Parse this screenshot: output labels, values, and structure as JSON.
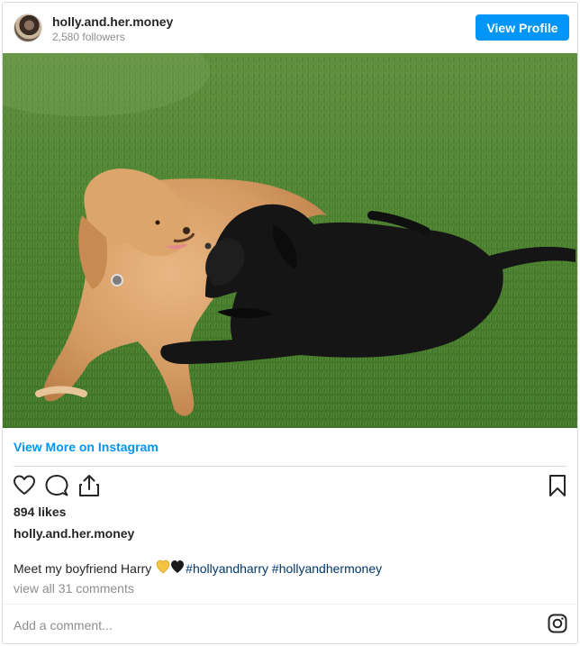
{
  "header": {
    "username": "holly.and.her.money",
    "followers": "2,580 followers",
    "view_profile_label": "View Profile"
  },
  "photo": {
    "description_icon": "two-dogs-photo"
  },
  "view_more_label": "View More on Instagram",
  "actions": {
    "like_icon": "heart-icon",
    "comment_icon": "comment-icon",
    "share_icon": "share-icon",
    "save_icon": "bookmark-icon"
  },
  "likes": "894 likes",
  "author": "holly.and.her.money",
  "caption": {
    "text": "Meet my boyfriend Harry ",
    "emoji_icons": [
      "yellow-heart-icon",
      "black-heart-icon"
    ],
    "hashtags": [
      "#hollyandharry",
      "#hollyandhermoney"
    ]
  },
  "comments_link": "view all 31 comments",
  "add_comment_placeholder": "Add a comment...",
  "colors": {
    "accent": "#0095f6",
    "hashtag": "#00376b",
    "muted": "#8e8e8e",
    "text": "#262626"
  }
}
